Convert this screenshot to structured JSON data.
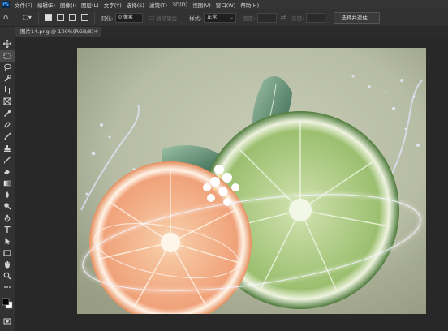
{
  "app": {
    "logo": "Ps"
  },
  "menu": [
    "文件(F)",
    "编辑(E)",
    "图像(I)",
    "图层(L)",
    "文字(Y)",
    "选择(S)",
    "滤镜(T)",
    "3D(D)",
    "视图(V)",
    "窗口(W)",
    "帮助(H)"
  ],
  "options": {
    "feather_label": "羽化:",
    "feather_value": "0 像素",
    "antialias_label": "消除锯齿",
    "style_label": "样式:",
    "style_value": "正常",
    "width_label": "宽度:",
    "height_label": "高度:",
    "select_subject_button": "选择并遮住..."
  },
  "document_tab": {
    "title": "图片14.png @ 100%(RGB/8) *",
    "close": "×"
  },
  "tools": [
    "move-icon",
    "marquee-icon",
    "lasso-icon",
    "quick-select-icon",
    "crop-icon",
    "frame-icon",
    "eyedropper-icon",
    "healing-brush-icon",
    "brush-icon",
    "clone-stamp-icon",
    "history-brush-icon",
    "eraser-icon",
    "gradient-icon",
    "blur-icon",
    "dodge-icon",
    "pen-icon",
    "type-icon",
    "path-select-icon",
    "rectangle-icon",
    "hand-icon",
    "zoom-icon",
    "more-tools-icon",
    "color-swatches-icon",
    "quick-mask-icon",
    "screen-mode-icon"
  ],
  "colors": {
    "accent": "#3fa4ff",
    "ui_bg": "#282828",
    "panel": "#323232"
  }
}
